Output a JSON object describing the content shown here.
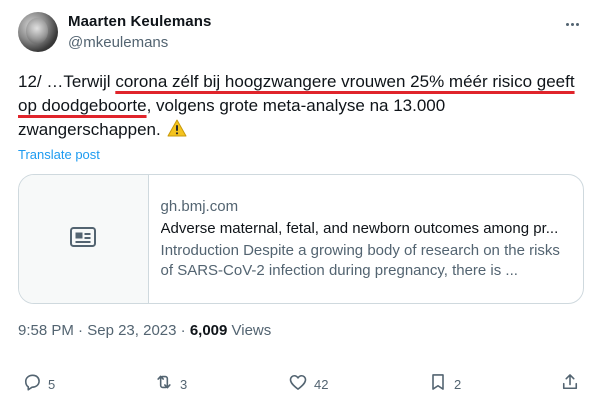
{
  "author": {
    "display_name": "Maarten Keulemans",
    "handle": "@mkeulemans"
  },
  "tweet": {
    "text_before": "12/ …Terwijl ",
    "text_highlight": "corona zélf bij hoogzwangere vrouwen 25% méér risico geeft op doodgeboorte",
    "text_after": ", volgens grote meta-analyse na 13.000 zwangerschappen.",
    "emoji_icon": "warning-sign-icon",
    "translate_label": "Translate post"
  },
  "card": {
    "domain": "gh.bmj.com",
    "title": "Adverse maternal, fetal, and newborn outcomes among pr...",
    "description": "Introduction Despite a growing body of research on the risks of SARS-CoV-2 infection during pregnancy, there is ...",
    "thumbnail_icon": "article-icon"
  },
  "meta": {
    "time": "9:58 PM",
    "separator": " · ",
    "date": "Sep 23, 2023",
    "separator2": " · ",
    "views_count": "6,009",
    "views_label": " Views"
  },
  "actions": {
    "replies": "5",
    "reposts": "3",
    "likes": "42",
    "bookmarks": "2"
  },
  "colors": {
    "accent": "#1d9bf0",
    "highlight_underline": "#e0242b",
    "secondary_text": "#536471",
    "border": "#cfd9de"
  }
}
